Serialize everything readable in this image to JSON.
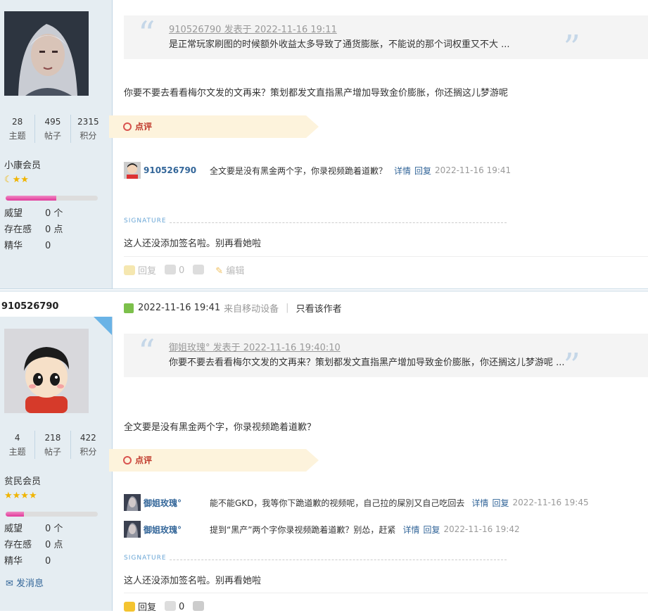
{
  "post1": {
    "stats": [
      {
        "num": "28",
        "label": "主题"
      },
      {
        "num": "495",
        "label": "帖子"
      },
      {
        "num": "2315",
        "label": "积分"
      }
    ],
    "group": "小康会员",
    "level_fill": 0.55,
    "kv": [
      {
        "k": "威望",
        "v": "0 个"
      },
      {
        "k": "存在感",
        "v": "0 点"
      },
      {
        "k": "精华",
        "v": "0"
      }
    ],
    "quote_meta": "910526790 发表于 2022-11-16 19:11",
    "quote_text": "是正常玩家刷图的时候额外收益太多导致了通货膨胀，不能说的那个词权重又不大 ...",
    "body": "你要不要去看看梅尔文发的文再来？策划都发文直指黑产增加导致金价膨胀，你还搁这儿梦游呢",
    "dianping": "点评",
    "comments": [
      {
        "user": "910526790",
        "text": "全文要是没有黑金两个字，你录视频跪着道歉？",
        "detail": "详情",
        "reply": "回复",
        "time": "2022-11-16 19:41"
      }
    ],
    "sig_label": "SIGNATURE",
    "sig_text": "这人还没添加签名啦。别再看她啦",
    "actions": {
      "reply": "回复",
      "like": "0",
      "edit": "编辑"
    }
  },
  "post2": {
    "author": "910526790",
    "time": "2022-11-16 19:41",
    "via": "来自移动设备",
    "only_author": "只看该作者",
    "stats": [
      {
        "num": "4",
        "label": "主题"
      },
      {
        "num": "218",
        "label": "帖子"
      },
      {
        "num": "422",
        "label": "积分"
      }
    ],
    "group": "贫民会员",
    "level_fill": 0.2,
    "kv": [
      {
        "k": "威望",
        "v": "0 个"
      },
      {
        "k": "存在感",
        "v": "0 点"
      },
      {
        "k": "精华",
        "v": "0"
      }
    ],
    "send_msg": "发消息",
    "quote_meta": "御姐玫瑰° 发表于 2022-11-16 19:40:10",
    "quote_text": "你要不要去看看梅尔文发的文再来？策划都发文直指黑产增加导致金价膨胀，你还搁这儿梦游呢 ...",
    "body": "全文要是没有黑金两个字，你录视频跪着道歉？",
    "dianping": "点评",
    "comments": [
      {
        "user": "御姐玫瑰°",
        "text": "能不能GKD，我等你下跪道歉的视频呢，自己拉的屎別又自己吃回去",
        "detail": "详情",
        "reply": "回复",
        "time": "2022-11-16 19:45"
      },
      {
        "user": "御姐玫瑰°",
        "text": "提到“黑产”两个字你录视频跪着道歉？别怂，赶紧",
        "detail": "详情",
        "reply": "回复",
        "time": "2022-11-16 19:42"
      }
    ],
    "sig_label": "SIGNATURE",
    "sig_text": "这人还没添加签名啦。别再看她啦",
    "actions": {
      "reply": "回复",
      "like": "0"
    }
  }
}
